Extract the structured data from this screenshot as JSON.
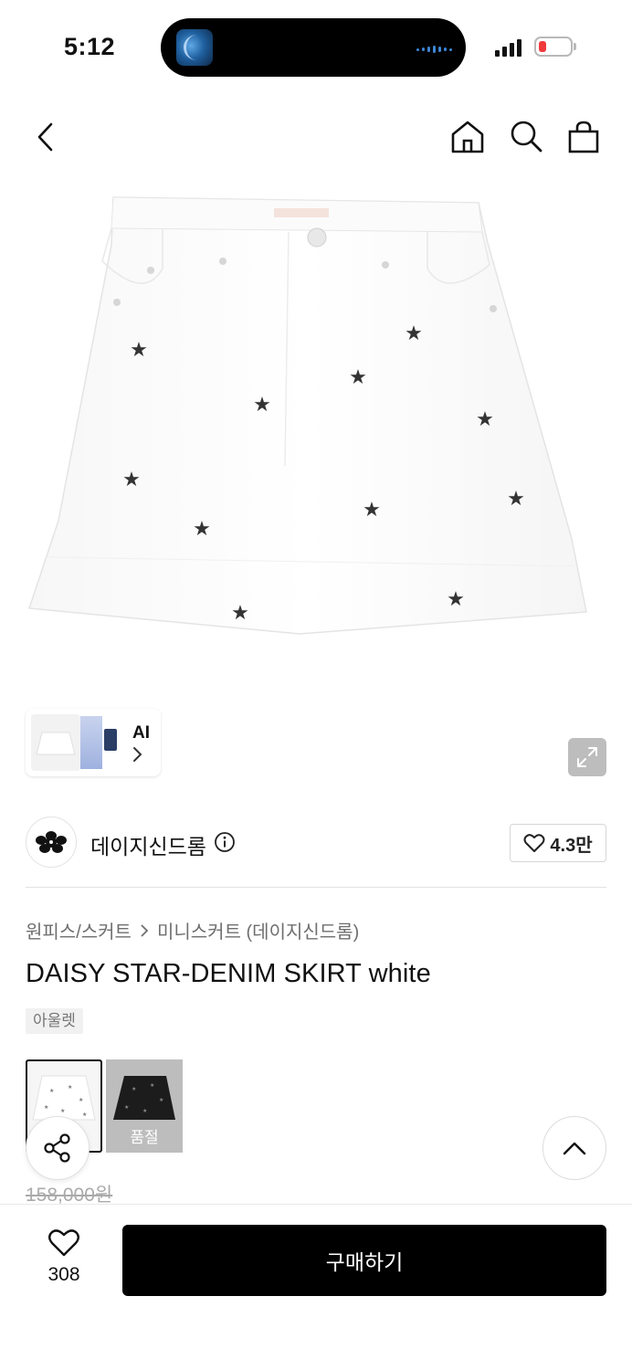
{
  "status_bar": {
    "time": "5:12"
  },
  "product_image": {
    "ai_label": "AI"
  },
  "brand": {
    "name": "데이지신드롬",
    "likes": "4.3만"
  },
  "breadcrumb": {
    "category": "원피스/스커트",
    "subcategory": "미니스커트 (데이지신드롬)"
  },
  "product": {
    "title": "DAISY STAR-DENIM SKIRT white",
    "tag": "아울렛",
    "variants": [
      {
        "name": "white",
        "selected": true,
        "soldout_label": ""
      },
      {
        "name": "black",
        "selected": false,
        "soldout_label": "품절"
      }
    ],
    "original_price": "158,000원"
  },
  "bottom_bar": {
    "wish_count": "308",
    "buy_label": "구매하기"
  },
  "colors": {
    "primary": "#000000",
    "sold_out_overlay": "#bdbdbd",
    "battery_low": "#f0393b"
  }
}
